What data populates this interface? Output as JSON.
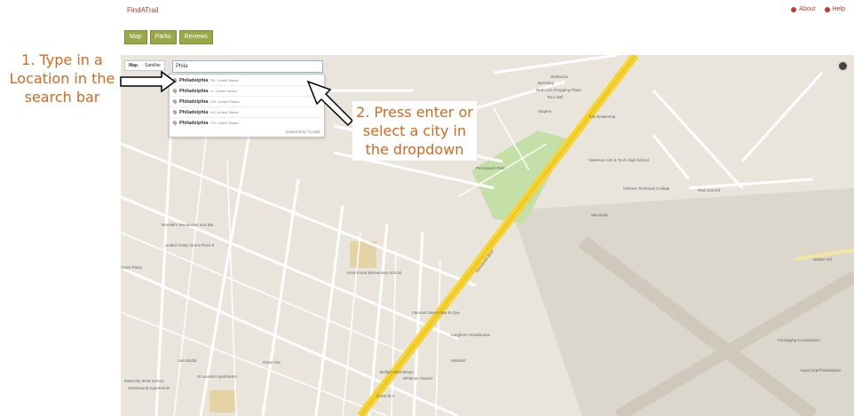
{
  "app": {
    "brand": "FindATrail"
  },
  "topnav": {
    "about": "About",
    "help": "Help"
  },
  "tabs": [
    {
      "label": "Map"
    },
    {
      "label": "Parks"
    },
    {
      "label": "Reviews"
    }
  ],
  "map_controls": {
    "map_label": "Map",
    "satellite_label": "Satellite"
  },
  "search": {
    "value": "Phila"
  },
  "suggestions": [
    {
      "match": "Philadelphia",
      "rest": "PA, United States"
    },
    {
      "match": "Philadelphia",
      "rest": "IL, United States"
    },
    {
      "match": "Philadelphia",
      "rest": "MS, United States"
    },
    {
      "match": "Philadelphia",
      "rest": "NY, United States"
    },
    {
      "match": "Philadelphia",
      "rest": "TN, United States"
    }
  ],
  "attribution": "powered by Google",
  "map_labels": {
    "roosevelt_blvd": "Roosevelt Blvd",
    "starbucks": "Starbucks",
    "best_buy": "Best Buy",
    "red_lion_center": "Red Lion Shopping Plaza",
    "taco_bell": "Taco Bell",
    "staples": "Staples",
    "kia": "Kia Dealership",
    "playground": "Pennypack Park",
    "swenson": "Swenson Arts & Tech High School",
    "orleans": "Orleans Technical College",
    "marshalls": "Marshalls",
    "anne_frank": "Anne Frank Elementary School",
    "rendells": "Rendell's Restaurant and Bar",
    "united_artists": "United Artists Grant Plaza 8",
    "grant_plaza": "Grant Plaza",
    "famous_daves": "Famous Dave's Bar-B-Que",
    "longhorn": "Longhorn Steakhouse",
    "walmart": "Walmart",
    "whitman_square": "Whitman Square",
    "buffalo": "Buffalo Wild Wings",
    "lbi_bridal": "L&H Bridal",
    "maternity": "Maternity BVM School",
    "st_laurent": "St Laurent Apartments",
    "greenwood": "Greenwood Apartments",
    "packaging": "Packaging Coordinators",
    "aqua": "AquaCorp/Philadelphia",
    "walton": "Walton Rd",
    "grant_ave": "Grant Ave",
    "red_lion_rd": "Red Lion Rd",
    "chick": "Chick-fil-A"
  },
  "annotations": {
    "step1": "1. Type in a Location in the search bar",
    "step2": "2. Press enter or select a city in the dropdown"
  },
  "colors": {
    "brand": "#c0392b",
    "tab_bg": "#9aa84a",
    "annotation_text": "#d2691e",
    "map_bg": "#e9e5dc",
    "highway": "#f7d330",
    "park": "#c4dfa8"
  }
}
